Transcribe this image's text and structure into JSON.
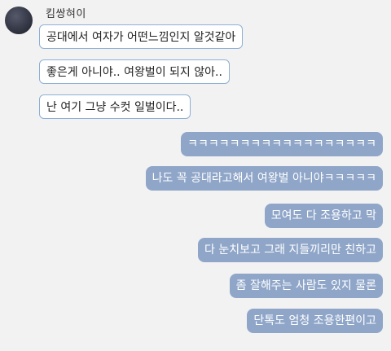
{
  "chat": {
    "sender_name": "킴쌍혀이",
    "received": [
      {
        "text": "공대에서 여자가 어떤느낌인지 알것같아"
      },
      {
        "text": "좋은게 아니야.. 여왕벌이 되지 않아.."
      },
      {
        "text": "난 여기 그냥 수컷 일벌이다.."
      }
    ],
    "sent": [
      {
        "text": "ㅋㅋㅋㅋㅋㅋㅋㅋㅋㅋㅋㅋㅋㅋㅋㅋㅋㅋ"
      },
      {
        "text": "나도 꼭 공대라고해서 여왕벌 아니야ㅋㅋㅋㅋㅋ"
      },
      {
        "text": "모여도 다 조용하고 막"
      },
      {
        "text": "다 눈치보고 그래 지들끼리만 친하고"
      },
      {
        "text": "좀 잘해주는 사람도 있지 물론"
      },
      {
        "text": "단톡도 엄청 조용한편이고"
      }
    ]
  }
}
